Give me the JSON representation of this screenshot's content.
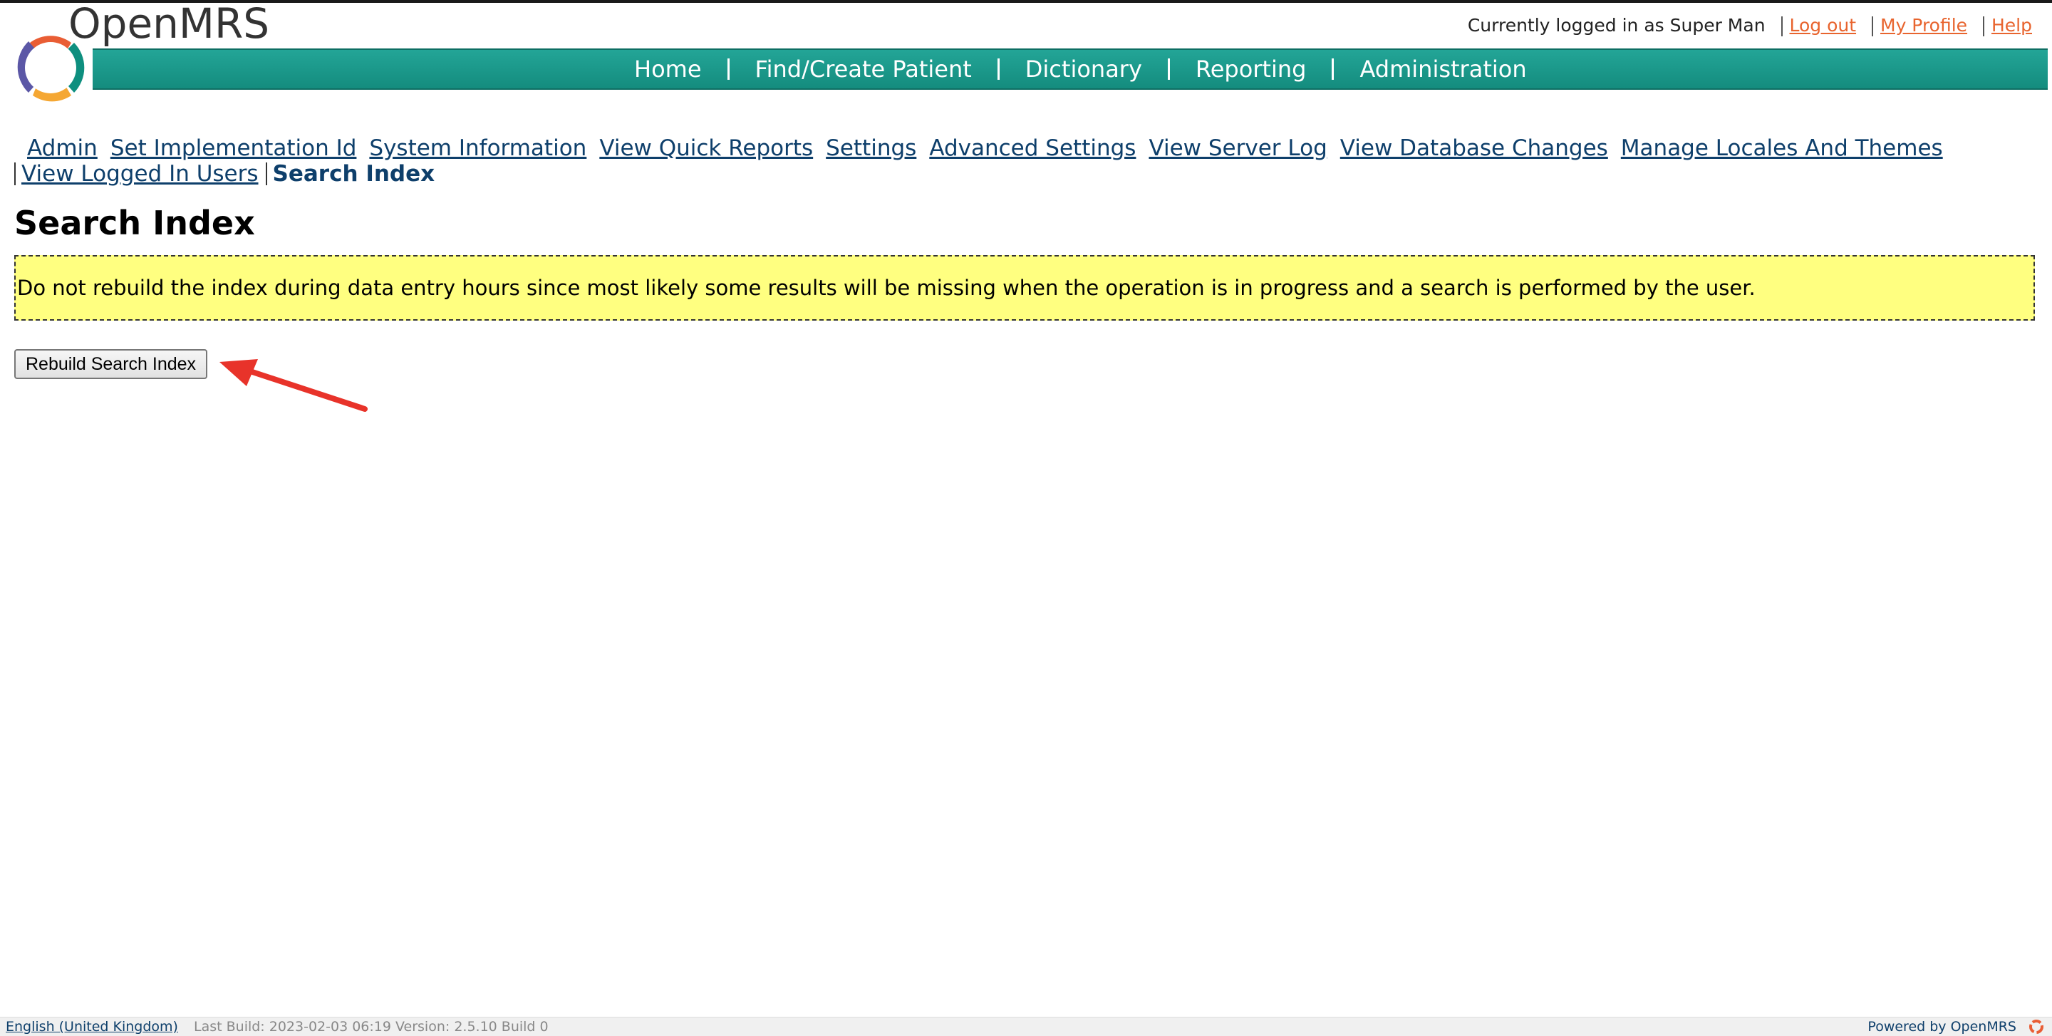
{
  "app": {
    "brand_name": "OpenMRS"
  },
  "user_bar": {
    "logged_in_text": "Currently logged in as Super Man",
    "logout": "Log out",
    "my_profile": "My Profile",
    "help": "Help"
  },
  "nav": {
    "home": "Home",
    "find_create_patient": "Find/Create Patient",
    "dictionary": "Dictionary",
    "reporting": "Reporting",
    "administration": "Administration"
  },
  "admin_menu": {
    "admin": "Admin",
    "set_implementation_id": "Set Implementation Id",
    "system_information": "System Information",
    "view_quick_reports": "View Quick Reports",
    "settings": "Settings",
    "advanced_settings": "Advanced Settings",
    "view_server_log": "View Server Log",
    "view_database_changes": "View Database Changes",
    "manage_locales_and_themes": "Manage Locales And Themes",
    "view_logged_in_users": "View Logged In Users",
    "search_index": "Search Index"
  },
  "page": {
    "title": "Search Index",
    "warning": "Do not rebuild the index during data entry hours since most likely some results will be missing when the operation is in progress and a search is performed by the user.",
    "rebuild_button": "Rebuild Search Index"
  },
  "footer": {
    "locale": "English (United Kingdom)",
    "build_info": "Last Build: 2023-02-03 06:19   Version: 2.5.10 Build 0",
    "powered_by": "Powered by OpenMRS"
  },
  "colors": {
    "nav_teal": "#1a9a8b",
    "link_blue": "#0e3f6b",
    "link_orange": "#e8642e",
    "warning_yellow": "#ffff80",
    "annotation_arrow": "#e8332a"
  },
  "icons": {
    "logo": "openmrs-logo-icon",
    "annotation": "red-arrow-icon",
    "footer": "openmrs-small-icon"
  }
}
